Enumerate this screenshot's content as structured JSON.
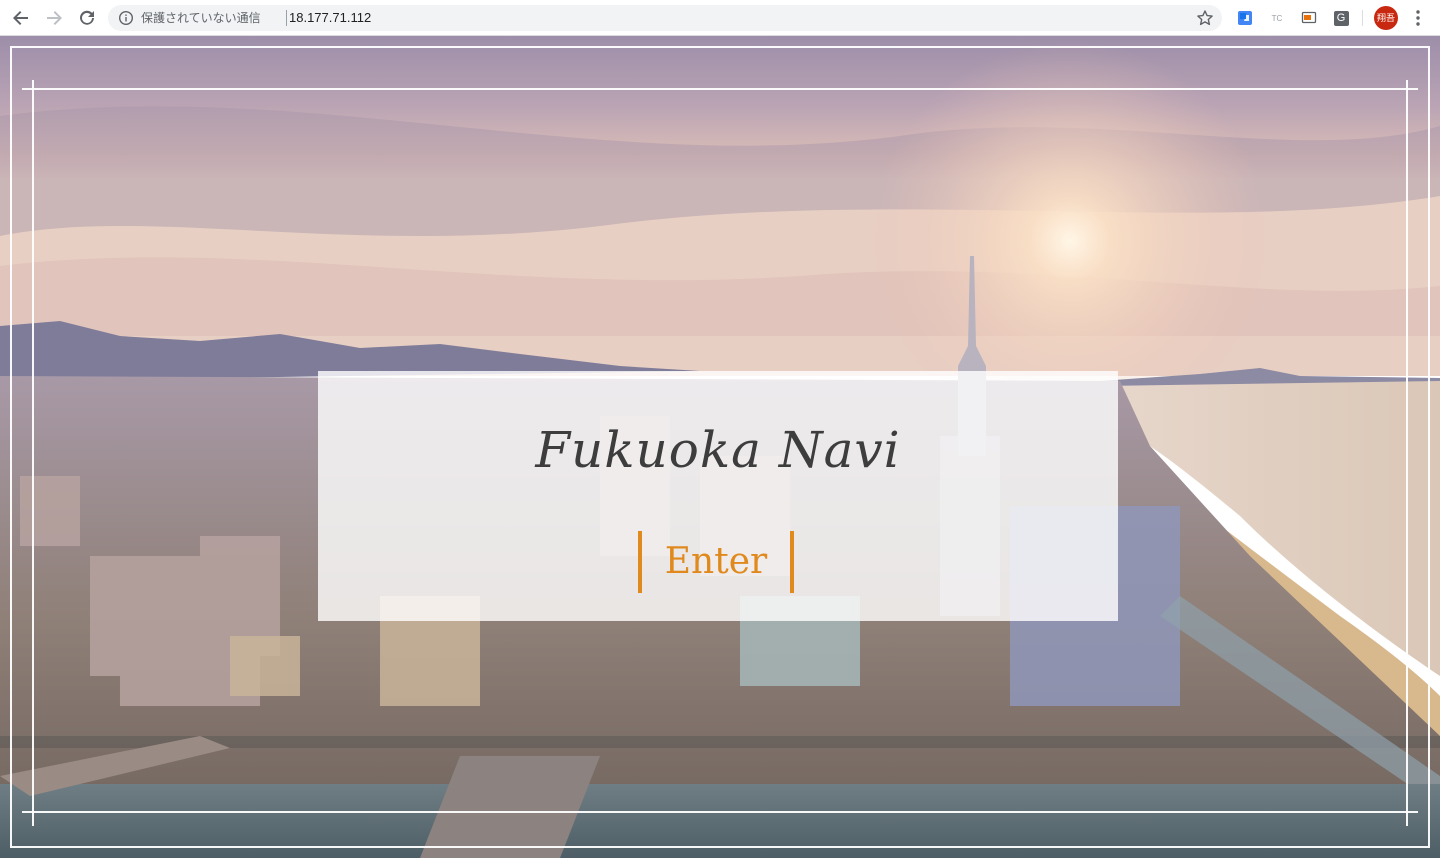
{
  "browser": {
    "security_text": "保護されていない通信",
    "url": "18.177.71.112",
    "extensions": [
      "google-translate-icon",
      "tc-icon",
      "cast-icon",
      "g-icon"
    ],
    "extension_labels": {
      "tc": "TC",
      "g": "G"
    },
    "profile_initials": "翔吾"
  },
  "page": {
    "title": "Fukuoka Navi",
    "enter_label": "Enter",
    "accent_color": "#e08a1e",
    "title_color": "#3d3d3d",
    "background": "aerial photo of Fukuoka city skyline at sunset with Fukuoka Tower and waterfront"
  }
}
